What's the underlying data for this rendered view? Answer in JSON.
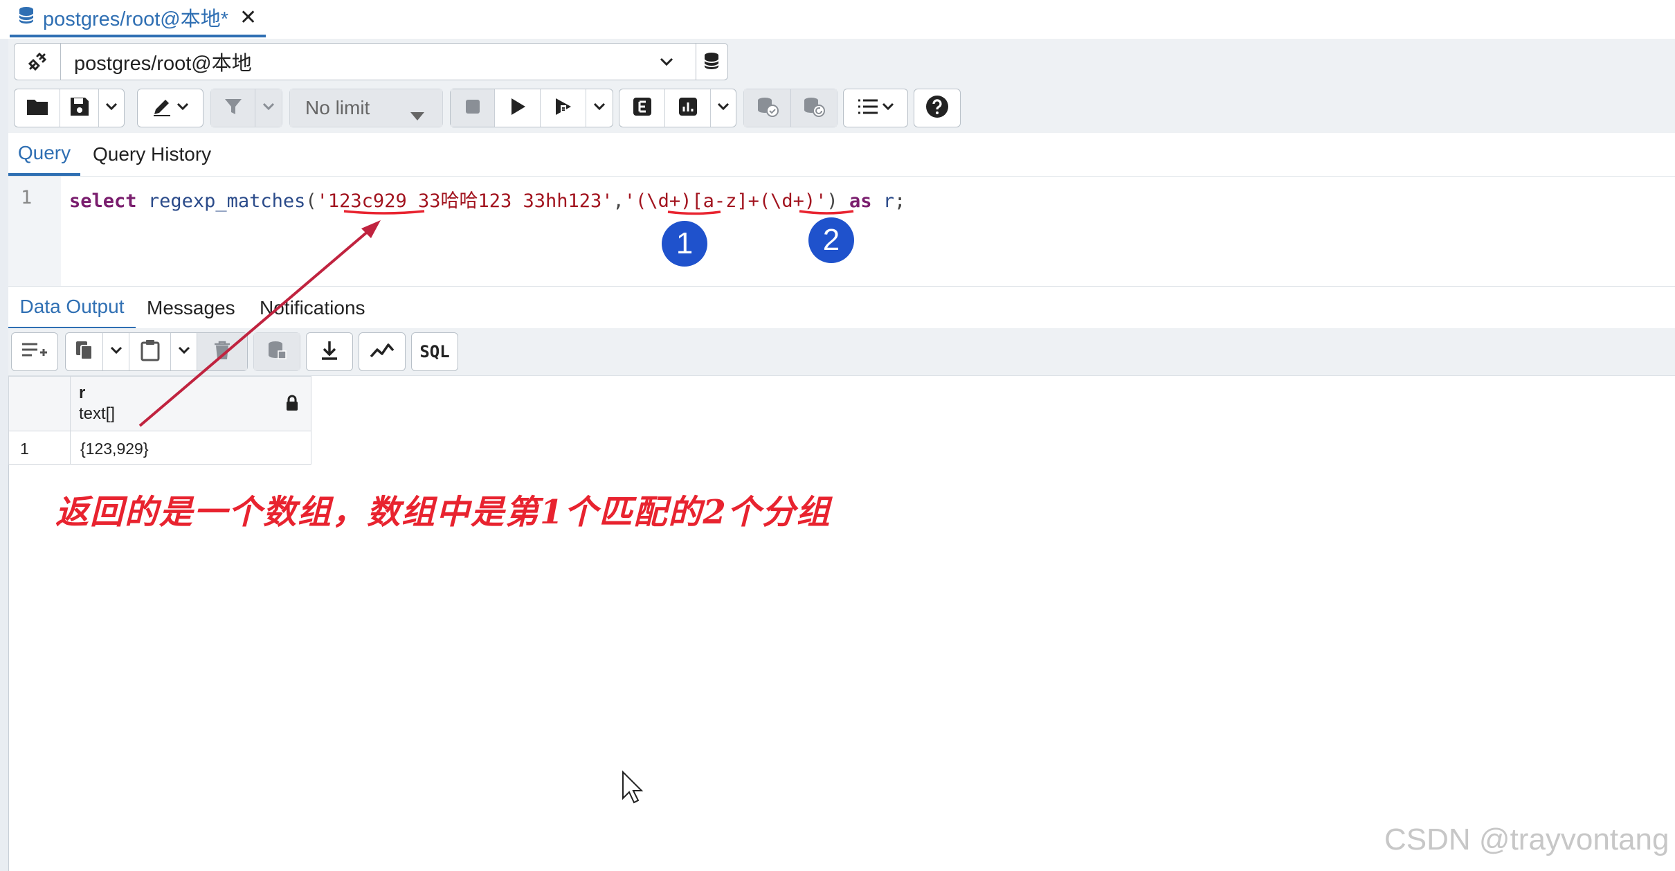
{
  "tab": {
    "title": "postgres/root@本地*",
    "close": "✕"
  },
  "connection": {
    "label": "postgres/root@本地"
  },
  "toolbar": {
    "limit_label": "No limit"
  },
  "query_tabs": [
    {
      "label": "Query"
    },
    {
      "label": "Query History"
    }
  ],
  "editor": {
    "line_number": "1",
    "tokens": {
      "kw_select": "select",
      "func": "regexp_matches",
      "open_paren": "(",
      "str1": "'123c929 33哈哈123 33hh123'",
      "comma": ",",
      "str2": "'(\\d+)[a-z]+(\\d+)'",
      "close_paren": ")",
      "kw_as": "as",
      "alias": "r",
      "semicolon": ";"
    }
  },
  "result_tabs": [
    {
      "label": "Data Output"
    },
    {
      "label": "Messages"
    },
    {
      "label": "Notifications"
    }
  ],
  "result_toolbar": {
    "sql_label": "SQL"
  },
  "grid": {
    "column": {
      "name": "r",
      "type": "text[]"
    },
    "rows": [
      {
        "num": "1",
        "value": "{123,929}"
      }
    ]
  },
  "annotation": {
    "text": "返回的是一个数组，数组中是第1个匹配的2个分组",
    "badge1": "1",
    "badge2": "2",
    "color": "#e8232f"
  },
  "watermark": "CSDN @trayvontang",
  "colors": {
    "accent": "#2f6fb3",
    "badge": "#1f52cc",
    "annotation": "#e8232f"
  }
}
